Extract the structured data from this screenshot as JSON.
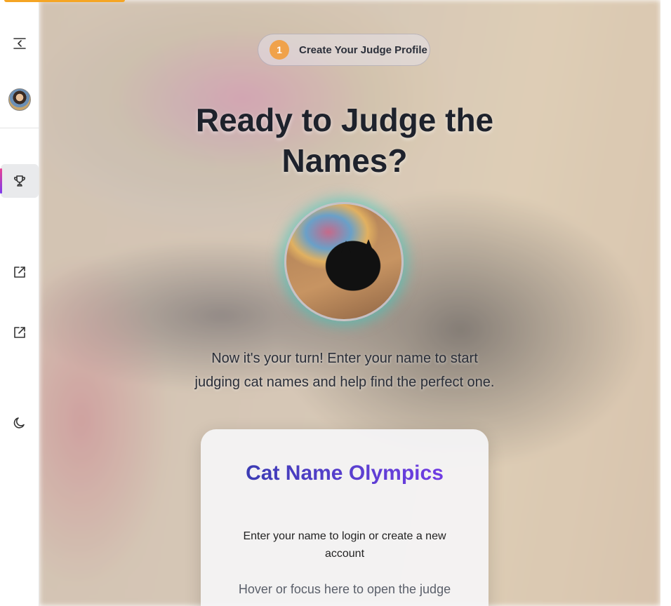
{
  "step": {
    "number": "1",
    "label": "Create Your Judge Profile"
  },
  "hero": {
    "title_line1": "Ready to Judge the",
    "title_line2": "Names?",
    "intro_line1": "Now it's your turn! Enter your name to start",
    "intro_line2": "judging cat names and help find the perfect one."
  },
  "card": {
    "title": "Cat Name Olympics",
    "subtitle": "Enter your name to login or create a new account",
    "hover_hint": "Hover or focus here to open the judge"
  },
  "sidebar": {
    "items": [
      {
        "icon": "collapse-sidebar-icon"
      },
      {
        "icon": "user-avatar"
      },
      {
        "icon": "trophy-icon",
        "active": true
      },
      {
        "icon": "external-link-icon"
      },
      {
        "icon": "external-link-icon"
      },
      {
        "icon": "moon-icon"
      }
    ]
  },
  "colors": {
    "step_badge": "#f0a24b",
    "active_bar_top": "#e84393",
    "active_bar_bottom": "#7c3aed",
    "title_gradient_start": "#2f3aa8",
    "title_gradient_end": "#7c3aed",
    "photo_glow": "#40c8be"
  }
}
